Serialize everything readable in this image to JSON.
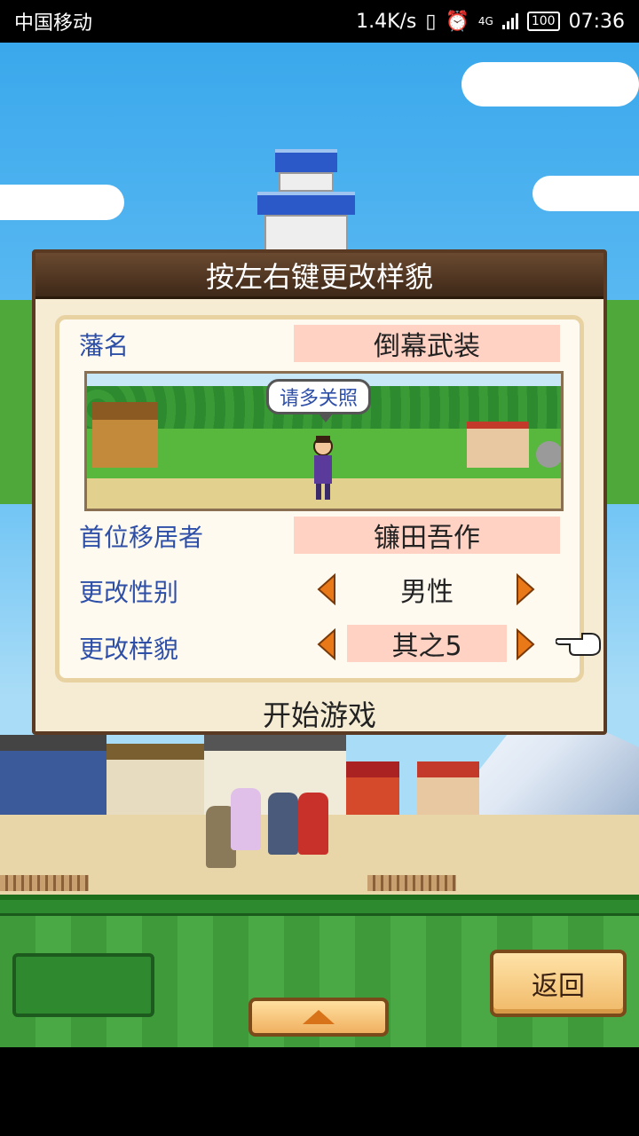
{
  "status_bar": {
    "carrier": "中国移动",
    "speed": "1.4K/s",
    "network": "4G",
    "battery": "100",
    "time": "07:36"
  },
  "dialog": {
    "title": "按左右键更改样貌",
    "domain_label": "藩名",
    "domain_value": "倒幕武装",
    "speech_bubble": "请多关照",
    "settler_label": "首位移居者",
    "settler_value": "镰田吾作",
    "gender_label": "更改性别",
    "gender_value": "男性",
    "appearance_label": "更改样貌",
    "appearance_value": "其之5",
    "start_label": "开始游戏"
  },
  "bottom": {
    "back_label": "返回"
  },
  "colors": {
    "label_blue": "#2e4fa8",
    "value_pink": "#ffd2c4",
    "arrow_orange": "#e87818",
    "header_brown": "#4e3420"
  }
}
